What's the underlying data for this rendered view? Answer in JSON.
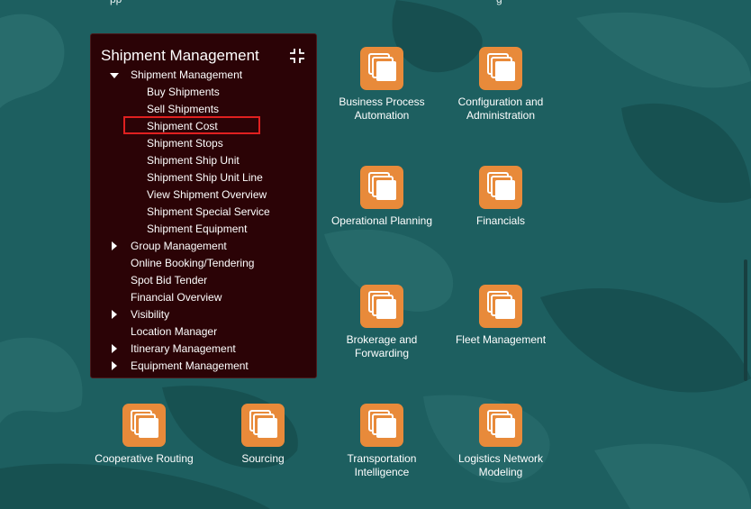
{
  "top_fragments": [
    "pp",
    "g"
  ],
  "panel": {
    "title": "Shipment Management",
    "items": [
      {
        "label": "Shipment Management",
        "level": 1,
        "arrow": "down"
      },
      {
        "label": "Buy Shipments",
        "level": 2,
        "arrow": ""
      },
      {
        "label": "Sell Shipments",
        "level": 2,
        "arrow": ""
      },
      {
        "label": "Shipment Cost",
        "level": 2,
        "arrow": "",
        "highlighted": true
      },
      {
        "label": "Shipment Stops",
        "level": 2,
        "arrow": ""
      },
      {
        "label": "Shipment Ship Unit",
        "level": 2,
        "arrow": ""
      },
      {
        "label": "Shipment Ship Unit Line",
        "level": 2,
        "arrow": ""
      },
      {
        "label": "View Shipment Overview",
        "level": 2,
        "arrow": ""
      },
      {
        "label": "Shipment Special Service",
        "level": 2,
        "arrow": ""
      },
      {
        "label": "Shipment Equipment",
        "level": 2,
        "arrow": ""
      },
      {
        "label": "Group Management",
        "level": 1,
        "arrow": "right"
      },
      {
        "label": "Online Booking/Tendering",
        "level": 1,
        "arrow": ""
      },
      {
        "label": "Spot Bid Tender",
        "level": 1,
        "arrow": ""
      },
      {
        "label": "Financial Overview",
        "level": 1,
        "arrow": ""
      },
      {
        "label": "Visibility",
        "level": 1,
        "arrow": "right"
      },
      {
        "label": "Location Manager",
        "level": 1,
        "arrow": ""
      },
      {
        "label": "Itinerary Management",
        "level": 1,
        "arrow": "right"
      },
      {
        "label": "Equipment Management",
        "level": 1,
        "arrow": "right"
      }
    ]
  },
  "tiles": [
    {
      "label": "Business Process Automation"
    },
    {
      "label": "Configuration and Administration"
    },
    {
      "label": "Operational Planning"
    },
    {
      "label": "Financials"
    },
    {
      "label": "Brokerage and Forwarding"
    },
    {
      "label": "Fleet Management"
    },
    {
      "label": "Cooperative Routing"
    },
    {
      "label": "Sourcing"
    },
    {
      "label": "Transportation Intelligence"
    },
    {
      "label": "Logistics Network Modeling"
    }
  ],
  "colors": {
    "background": "#1d5f60",
    "panel_bg": "#2b0306",
    "tile_icon": "#e88a3a",
    "highlight": "#e02020"
  }
}
